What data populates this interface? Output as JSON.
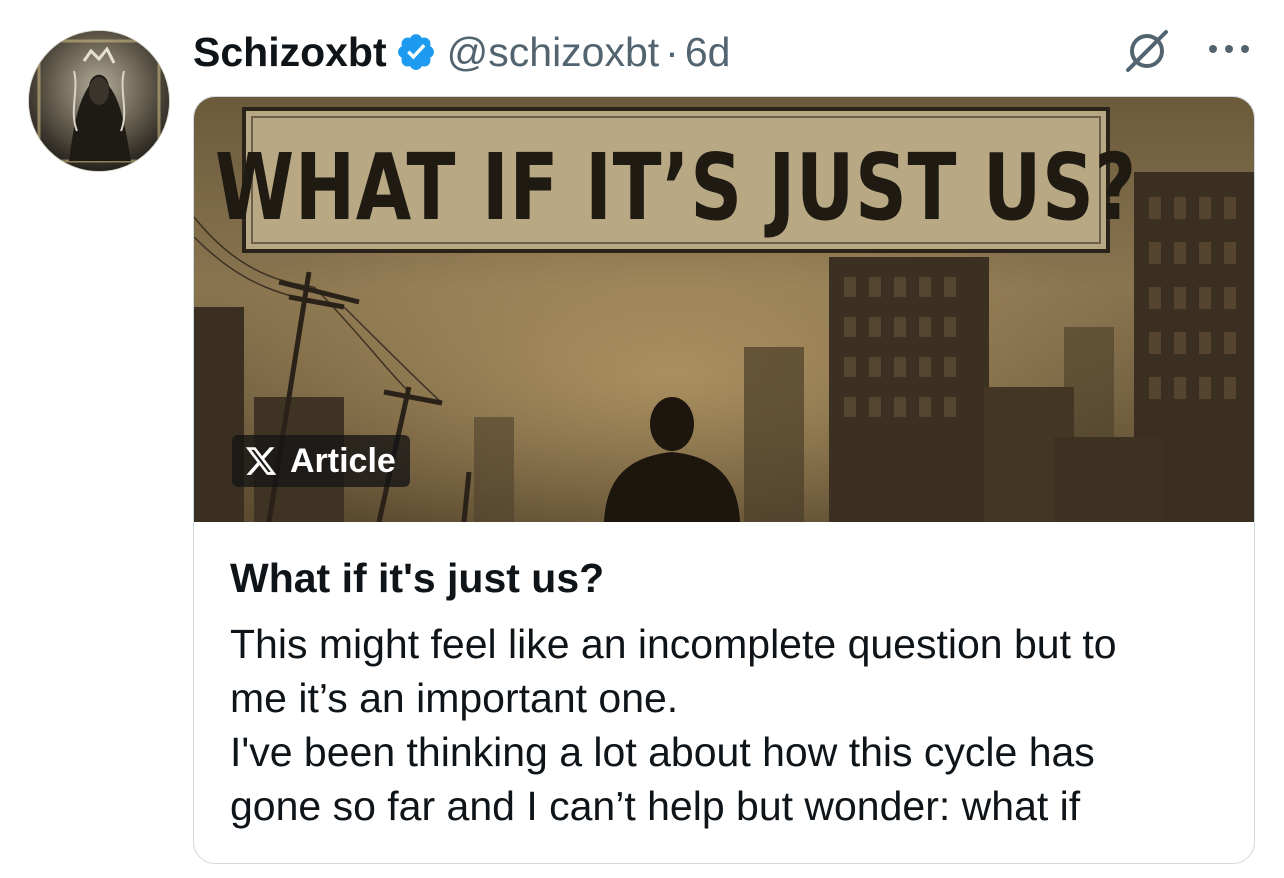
{
  "post": {
    "author": {
      "display_name": "Schizoxbt",
      "handle": "@schizoxbt",
      "verified": true,
      "avatar_icon": "avatar-image"
    },
    "separator": "·",
    "time_ago": "6d",
    "header_icons": [
      "grok-icon",
      "more-icon"
    ],
    "article_card": {
      "image_sign_text": "WHAT IF IT’S JUST US?",
      "badge_label": "Article",
      "title": "What if it's just us?",
      "snippet_lines": [
        "This might feel like an incomplete question but to",
        "me it’s an important one.",
        "I've been thinking a lot about how this cycle has",
        "gone so far and I can’t help but wonder: what if"
      ]
    }
  },
  "colors": {
    "text_primary": "#0f1419",
    "text_secondary": "#536471",
    "verified_blue": "#1d9bf0",
    "card_border": "#cfd9de"
  }
}
